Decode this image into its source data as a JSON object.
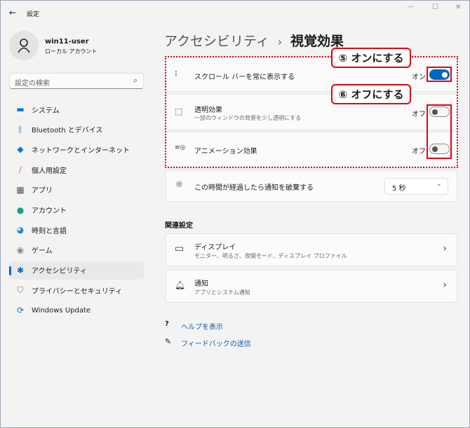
{
  "window": {
    "title": "設定",
    "back": "←",
    "min": "—",
    "max": "☐",
    "close": "✕"
  },
  "user": {
    "name": "win11-user",
    "type": "ローカル アカウント"
  },
  "search": {
    "placeholder": "設定の検索",
    "icon": "⌕"
  },
  "nav": [
    {
      "label": "システム",
      "icon": "▬",
      "color": "#0078d4"
    },
    {
      "label": "Bluetooth とデバイス",
      "icon": "ᛒ",
      "color": "#0078d4"
    },
    {
      "label": "ネットワークとインターネット",
      "icon": "◆",
      "color": "#0078d4"
    },
    {
      "label": "個人用設定",
      "icon": "∕",
      "color": "#e8703a"
    },
    {
      "label": "アプリ",
      "icon": "▦",
      "color": "#555"
    },
    {
      "label": "アカウント",
      "icon": "●",
      "color": "#1aa088"
    },
    {
      "label": "時刻と言語",
      "icon": "◕",
      "color": "#2a8ad4"
    },
    {
      "label": "ゲーム",
      "icon": "◉",
      "color": "#888"
    },
    {
      "label": "アクセシビリティ",
      "icon": "✱",
      "color": "#0067c0",
      "selected": true
    },
    {
      "label": "プライバシーとセキュリティ",
      "icon": "⛉",
      "color": "#777"
    },
    {
      "label": "Windows Update",
      "icon": "⟳",
      "color": "#0078d4"
    }
  ],
  "breadcrumb": {
    "parent": "アクセシビリティ",
    "sep": "›",
    "current": "視覚効果"
  },
  "settings": [
    {
      "title": "スクロール バーを常に表示する",
      "state": "オン",
      "on": true,
      "icon": "⁝"
    },
    {
      "title": "透明効果",
      "desc": "一部のウィンドウの背景を少し透明にする",
      "state": "オフ",
      "on": false,
      "icon": "⬚"
    },
    {
      "title": "アニメーション効果",
      "state": "オフ",
      "on": false,
      "icon": "≡◎"
    }
  ],
  "notify_timeout": {
    "title": "この時間が経過したら通知を破棄する",
    "value": "5 秒",
    "icon": "☼",
    "chevron": "⌄"
  },
  "related": {
    "heading": "関連設定",
    "items": [
      {
        "title": "ディスプレイ",
        "desc": "モニター、明るさ、夜間モード、ディスプレイ プロファイル",
        "icon": "▭"
      },
      {
        "title": "通知",
        "desc": "アプリとシステム通知",
        "icon": "🔔︎"
      }
    ],
    "chevron": "›"
  },
  "links": [
    {
      "label": "ヘルプを表示",
      "icon": "?"
    },
    {
      "label": "フィードバックの送信",
      "icon": "✎"
    }
  ],
  "annotations": {
    "step5": "⑤ オンにする",
    "step6": "⑥ オフにする",
    "color": "#e60012"
  }
}
